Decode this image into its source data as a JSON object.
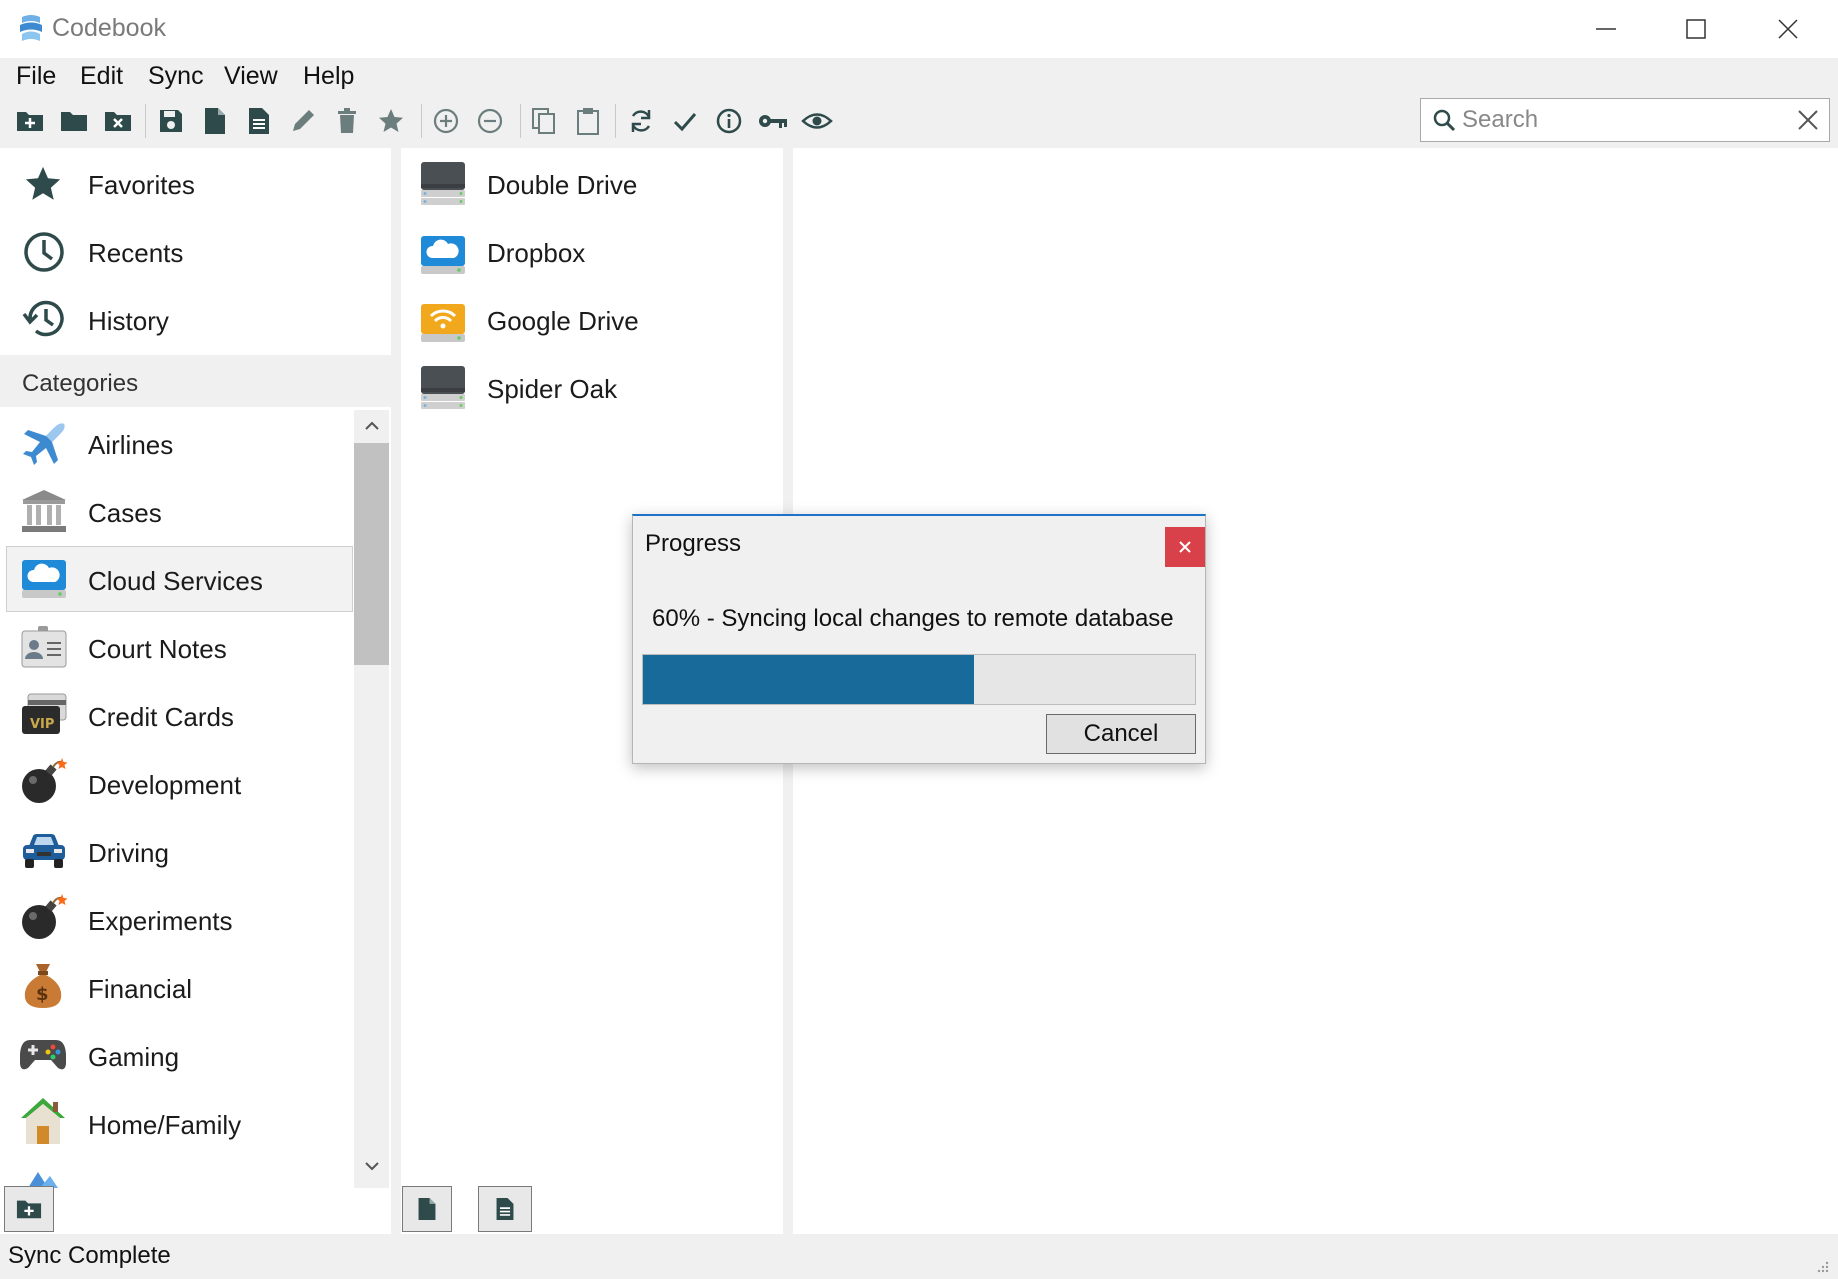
{
  "window": {
    "title": "Codebook"
  },
  "menu": [
    "File",
    "Edit",
    "Sync",
    "View",
    "Help"
  ],
  "toolbar": {
    "icons": [
      "new-folder-icon",
      "open-folder-icon",
      "close-folder-icon",
      "save-icon",
      "new-file-icon",
      "new-document-icon",
      "edit-pencil-icon",
      "trash-icon",
      "star-icon",
      "add-circle-icon",
      "remove-circle-icon",
      "copy-icon",
      "paste-icon",
      "sync-icon",
      "check-icon",
      "info-icon",
      "key-icon",
      "eye-icon"
    ]
  },
  "search": {
    "placeholder": "Search",
    "value": ""
  },
  "nav": [
    {
      "label": "Favorites",
      "icon": "star-icon"
    },
    {
      "label": "Recents",
      "icon": "clock-icon"
    },
    {
      "label": "History",
      "icon": "history-icon"
    }
  ],
  "categories": {
    "header": "Categories",
    "selected": "Cloud Services",
    "items": [
      {
        "label": "Airlines",
        "icon": "airplane-icon"
      },
      {
        "label": "Cases",
        "icon": "bank-building-icon"
      },
      {
        "label": "Cloud Services",
        "icon": "cloud-drive-icon"
      },
      {
        "label": "Court Notes",
        "icon": "id-card-icon"
      },
      {
        "label": "Credit Cards",
        "icon": "vip-card-icon"
      },
      {
        "label": "Development",
        "icon": "bomb-icon"
      },
      {
        "label": "Driving",
        "icon": "car-icon"
      },
      {
        "label": "Experiments",
        "icon": "bomb-icon"
      },
      {
        "label": "Financial",
        "icon": "money-bag-icon"
      },
      {
        "label": "Gaming",
        "icon": "gamepad-icon"
      },
      {
        "label": "Home/Family",
        "icon": "house-icon"
      }
    ]
  },
  "entries": [
    {
      "label": "Double Drive",
      "icon": "server-drive-icon"
    },
    {
      "label": "Dropbox",
      "icon": "cloud-drive-icon"
    },
    {
      "label": "Google Drive",
      "icon": "wifi-drive-icon"
    },
    {
      "label": "Spider Oak",
      "icon": "server-drive-icon"
    }
  ],
  "status": {
    "text": "Sync Complete"
  },
  "dialog": {
    "title": "Progress",
    "message": "60% - Syncing local changes to remote database",
    "progress": 0.6,
    "cancel_label": "Cancel"
  },
  "colors": {
    "accent": "#176a9a",
    "icon": "#2e4a4a",
    "close_red": "#d9414a",
    "window_border": "#2f6fb8"
  }
}
